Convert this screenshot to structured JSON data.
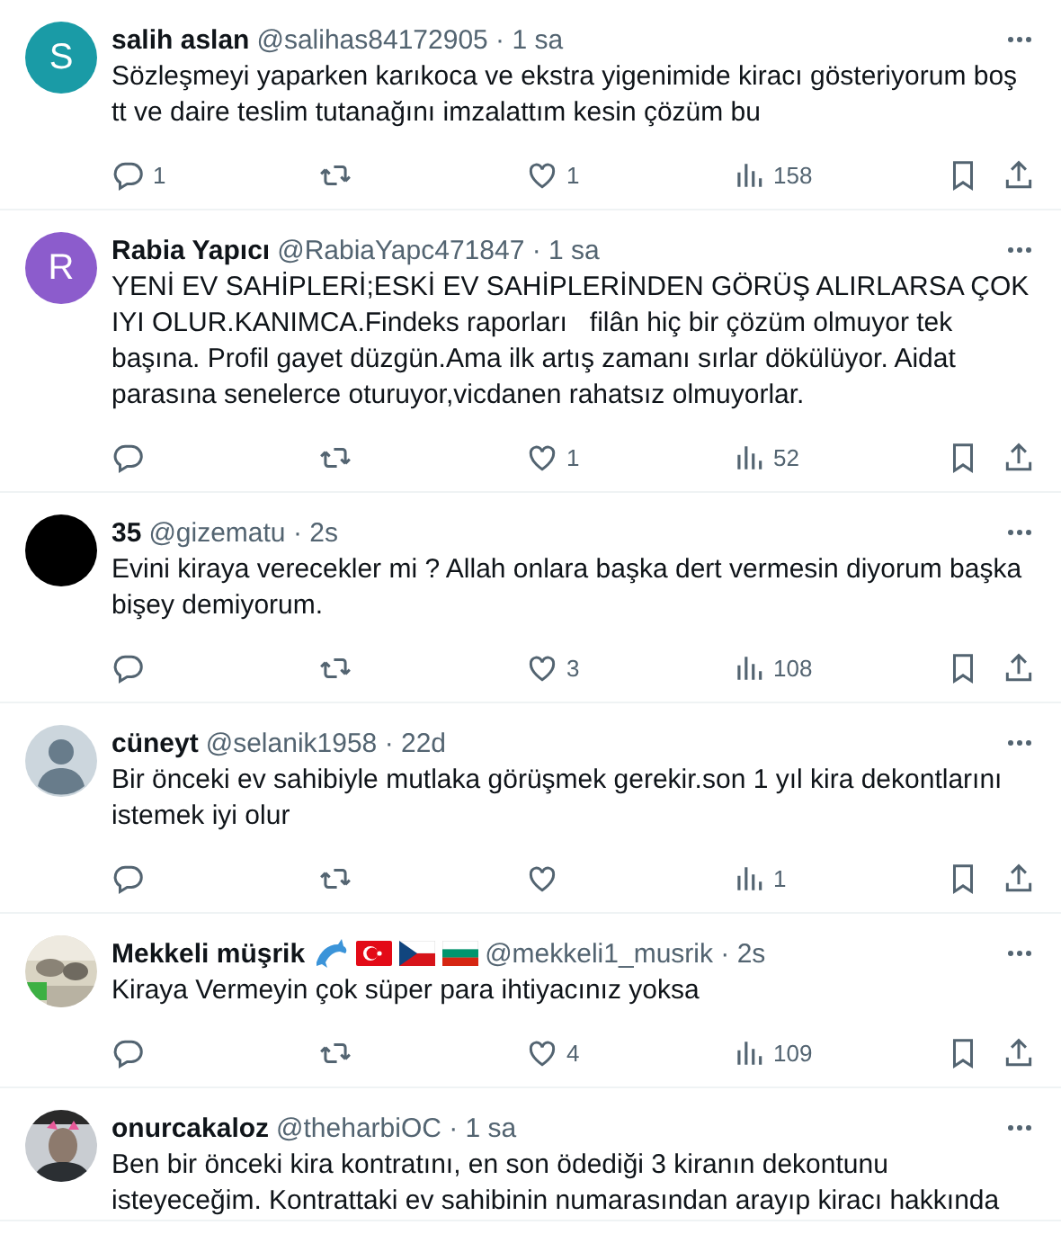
{
  "tweets": [
    {
      "avatar": {
        "kind": "letter",
        "letter": "S",
        "color": "#1a9ba6"
      },
      "name": "salih aslan",
      "meta": "@salihas84172905 · 1 sa",
      "text": "Sözleşmeyi yaparken karıkoca ve ekstra yigenimide kiracı gösteriyorum boş tt ve daire teslim tutanağını imzalattım kesin çözüm bu",
      "stats": {
        "replies": "1",
        "likes": "1",
        "views": "158"
      }
    },
    {
      "avatar": {
        "kind": "letter",
        "letter": "R",
        "color": "#8c5ccc"
      },
      "name": "Rabia Yapıcı",
      "meta": "@RabiaYapc471847 · 1 sa",
      "text": "YENİ EV SAHİPLERİ;ESKİ EV SAHİPLERİNDEN GÖRÜŞ ALIRLARSA ÇOK IYI OLUR.KANIMCA.Findeks raporları   filân hiç bir çözüm olmuyor tek başına. Profil gayet düzgün.Ama ilk artış zamanı sırlar dökülüyor. Aidat parasına senelerce oturuyor,vicdanen rahatsız olmuyorlar.",
      "stats": {
        "likes": "1",
        "views": "52"
      }
    },
    {
      "avatar": {
        "kind": "plain",
        "color": "#000000"
      },
      "name": "35",
      "meta": "@gizematu · 2s",
      "text": "Evini kiraya verecekler mi ? Allah onlara başka dert vermesin diyorum başka bişey demiyorum.",
      "stats": {
        "likes": "3",
        "views": "108"
      }
    },
    {
      "avatar": {
        "kind": "default"
      },
      "name": "cüneyt",
      "meta": "@selanik1958 · 22d",
      "text": "Bir önceki ev sahibiyle mutlaka görüşmek gerekir.son 1 yıl kira dekontlarını istemek iyi olur",
      "stats": {
        "views": "1"
      }
    },
    {
      "name": "Mekkeli müşrik",
      "name_emoji": [
        {
          "kind": "dolphin"
        },
        {
          "kind": "turkey-flag"
        },
        {
          "kind": "czech-flag"
        },
        {
          "kind": "bulgaria-flag"
        }
      ],
      "meta": "@mekkeli1_musrik · 2s",
      "text": "Kiraya Vermeyin çok süper para ihtiyacınız yoksa",
      "stats": {
        "likes": "4",
        "views": "109"
      }
    },
    {
      "name": "onurcakaloz",
      "meta": "@theharbiOC · 1 sa",
      "text": "Ben bir önceki kira kontratını, en son ödediği 3 kiranın dekontunu isteyeceğim. Kontrattaki ev sahibinin numarasından arayıp kiracı hakkında"
    }
  ]
}
